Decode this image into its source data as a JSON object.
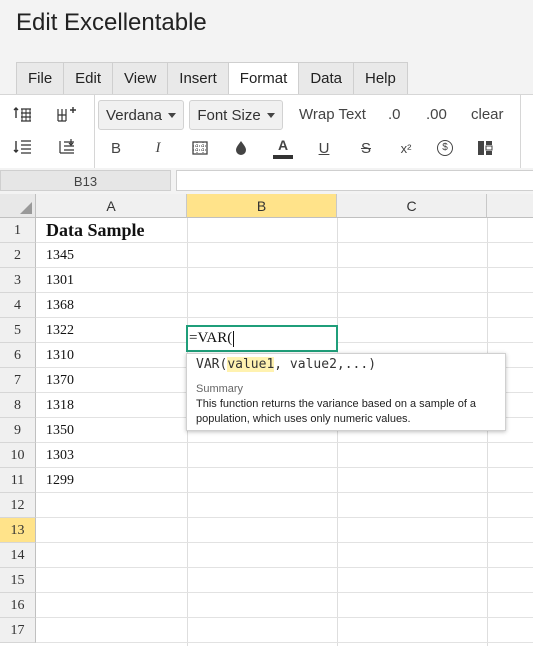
{
  "app": {
    "title": "Edit Excellentable"
  },
  "menu": {
    "tabs": [
      "File",
      "Edit",
      "View",
      "Insert",
      "Format",
      "Data",
      "Help"
    ],
    "active": "Format"
  },
  "toolbar": {
    "font_family": "Verdana",
    "font_size": "Font Size",
    "wrap_text": "Wrap Text",
    "decimal_decrease": ".0",
    "decimal_increase": ".00",
    "clear": "clear",
    "bold": "B",
    "italic": "I",
    "font_color": "A",
    "underline": "U",
    "strike": "S",
    "superscript": "x²",
    "currency": "$",
    "icons": [
      "insert-row-above-icon",
      "insert-column-right-icon",
      "indent-decrease-icon",
      "indent-increase-icon",
      "borders-icon",
      "fill-color-icon",
      "conditional-format-icon"
    ]
  },
  "formula_bar": {
    "cell_ref": "B13",
    "value": ""
  },
  "grid": {
    "columns": [
      "A",
      "B",
      "C"
    ],
    "selected_column": "B",
    "rows": [
      "1",
      "2",
      "3",
      "4",
      "5",
      "6",
      "7",
      "8",
      "9",
      "10",
      "11",
      "12",
      "13",
      "14",
      "15",
      "16",
      "17"
    ],
    "selected_row": "13",
    "colA": [
      "Data Sample",
      "1345",
      "1301",
      "1368",
      "1322",
      "1310",
      "1370",
      "1318",
      "1350",
      "1303",
      "1299",
      "",
      "",
      "",
      "",
      "",
      ""
    ]
  },
  "editor": {
    "text": "=VAR("
  },
  "autocomplete": {
    "func": "VAR(",
    "param1": "value1",
    "rest": ", value2,...)",
    "summary_label": "Summary",
    "summary_text": "This function returns the variance based on a sample of a population, which uses only numeric values."
  },
  "colors": {
    "selection_header": "#ffe38a",
    "editor_border": "#1f9e7a",
    "font_color_bar": "#333333"
  }
}
